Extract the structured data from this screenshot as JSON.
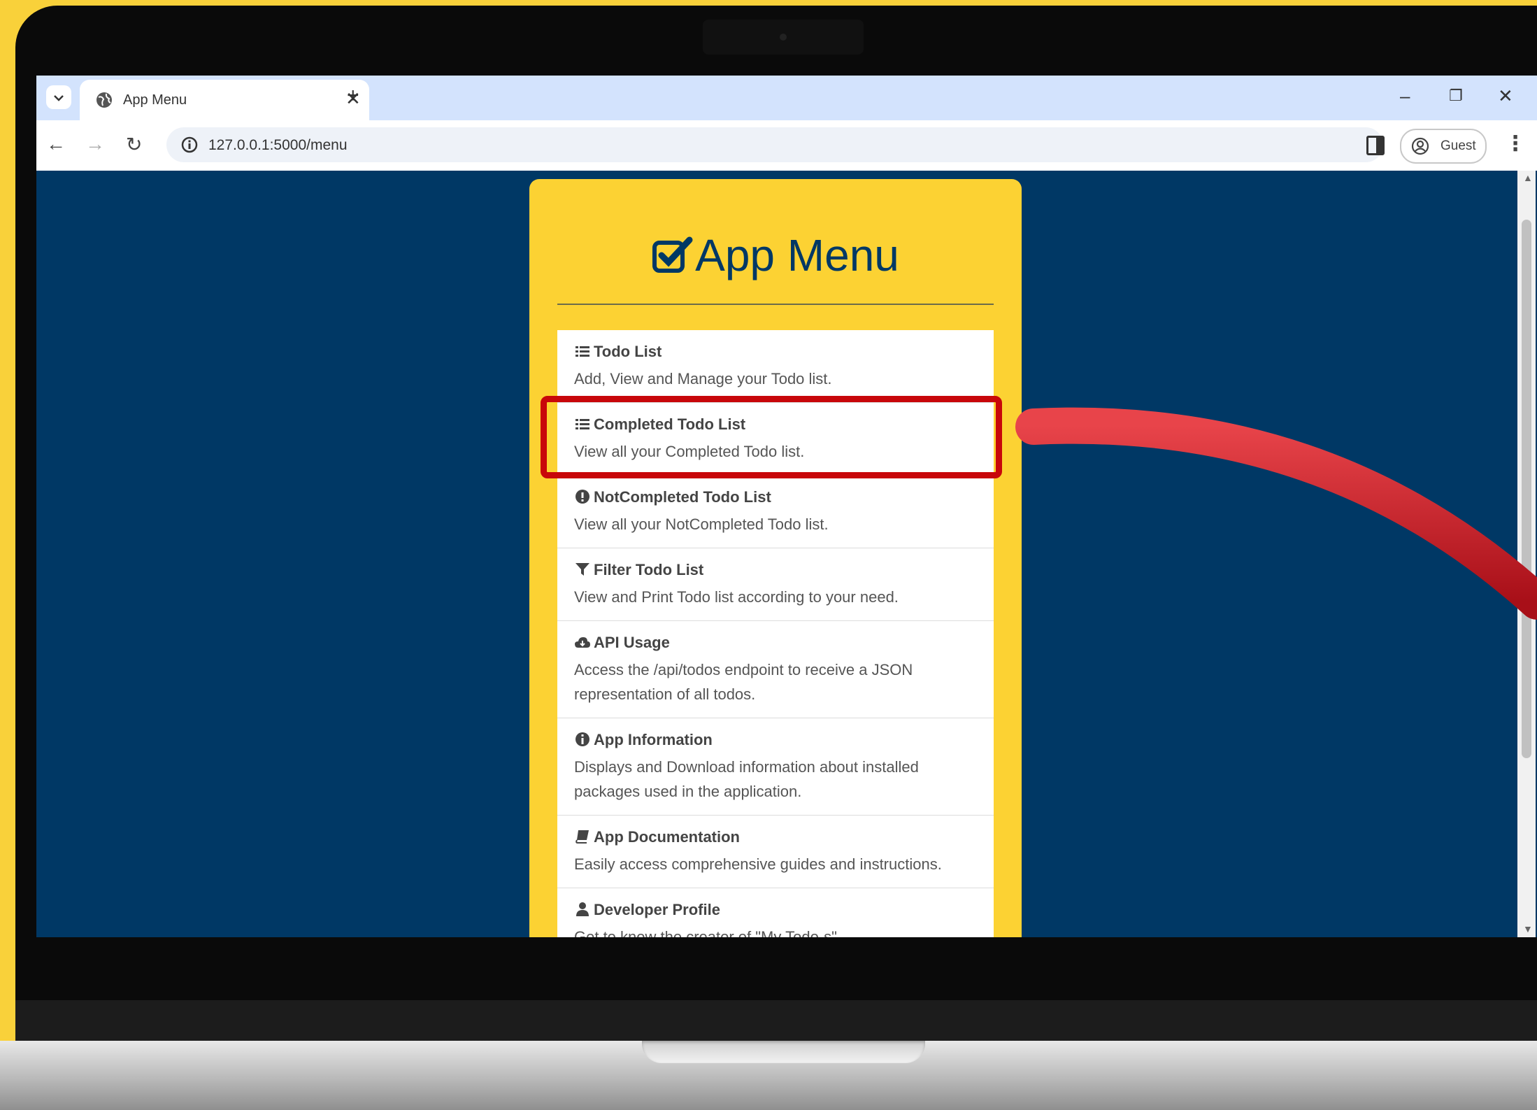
{
  "browser": {
    "tab_title": "App Menu",
    "new_tab_symbol": "+",
    "url": "127.0.0.1:5000/menu",
    "profile_label": "Guest"
  },
  "menu": {
    "title": "App Menu",
    "items": [
      {
        "icon": "list-icon",
        "title": "Todo List",
        "desc": "Add, View and Manage your Todo list."
      },
      {
        "icon": "list-ul-icon",
        "title": "Completed Todo List",
        "desc": "View all your Completed Todo list."
      },
      {
        "icon": "exclamation-circle-icon",
        "title": "NotCompleted Todo List",
        "desc": "View all your NotCompleted Todo list."
      },
      {
        "icon": "filter-icon",
        "title": "Filter Todo List",
        "desc": "View and Print Todo list according to your need."
      },
      {
        "icon": "cloud-icon",
        "title": "API Usage",
        "desc": "Access the /api/todos endpoint to receive a JSON representation of all todos."
      },
      {
        "icon": "info-circle-icon",
        "title": "App Information",
        "desc": "Displays and Download information about installed packages used in the application."
      },
      {
        "icon": "book-icon",
        "title": "App Documentation",
        "desc": "Easily access comprehensive guides and instructions."
      },
      {
        "icon": "user-icon",
        "title": "Developer Profile",
        "desc": "Get to know the creator of \"My Todo-s\""
      }
    ]
  },
  "annotation": {
    "highlight_color": "#c8070a",
    "highlighted_item": "Completed Todo List"
  }
}
